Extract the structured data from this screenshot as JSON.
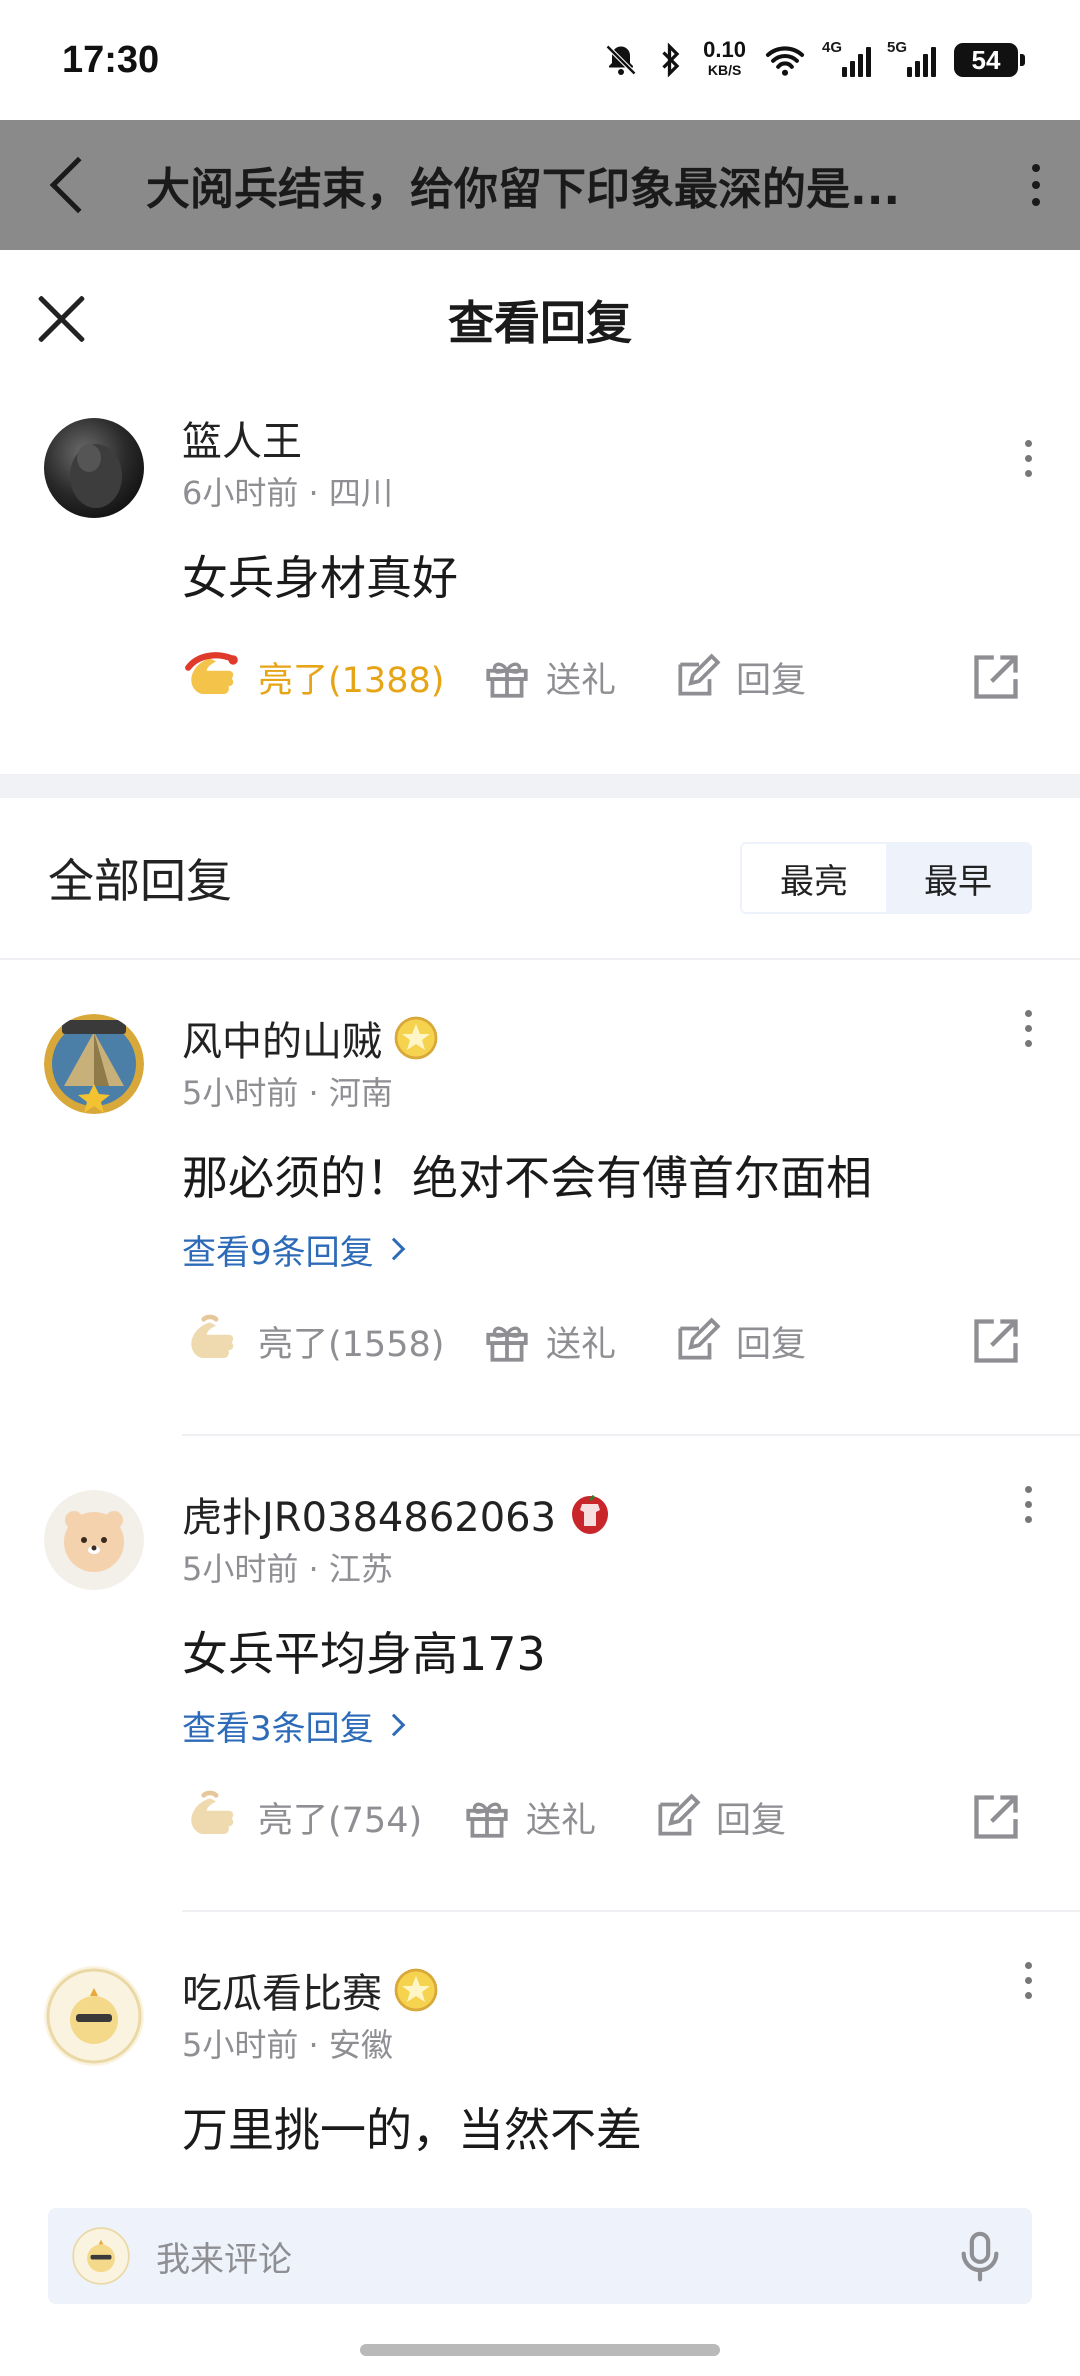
{
  "status_bar": {
    "time": "17:30",
    "net_speed": "0.10",
    "net_unit": "KB/S",
    "sig1": "4G",
    "sig2": "5G",
    "battery": "54"
  },
  "nav": {
    "title": "大阅兵结束，给你留下印象最深的是..."
  },
  "sheet": {
    "title": "查看回复"
  },
  "main_comment": {
    "username": "篮人王",
    "meta": "6小时前 · 四川",
    "content": "女兵身材真好",
    "like_label": "亮了(1388)",
    "gift_label": "送礼",
    "reply_label": "回复"
  },
  "replies_header": {
    "label": "全部回复",
    "sort_options": [
      "最亮",
      "最早"
    ],
    "active_sort": "最早"
  },
  "replies": [
    {
      "username": "风中的山贼",
      "meta": "5小时前 · 河南",
      "content": "那必须的！绝对不会有傅首尔面相",
      "view_replies": "查看9条回复",
      "like_label": "亮了(1558)",
      "gift_label": "送礼",
      "reply_label": "回复"
    },
    {
      "username": "虎扑JR0384862063",
      "meta": "5小时前 · 江苏",
      "content": "女兵平均身高173",
      "view_replies": "查看3条回复",
      "like_label": "亮了(754)",
      "gift_label": "送礼",
      "reply_label": "回复"
    },
    {
      "username": "吃瓜看比赛",
      "meta": "5小时前 · 安徽",
      "content": "万里挑一的，当然不差"
    }
  ],
  "input_bar": {
    "placeholder": "我来评论"
  },
  "colors": {
    "link": "#2d6bb8",
    "liked": "#e6a417",
    "muted": "#8e8e93",
    "dim_overlay": "#8a8a8a"
  }
}
